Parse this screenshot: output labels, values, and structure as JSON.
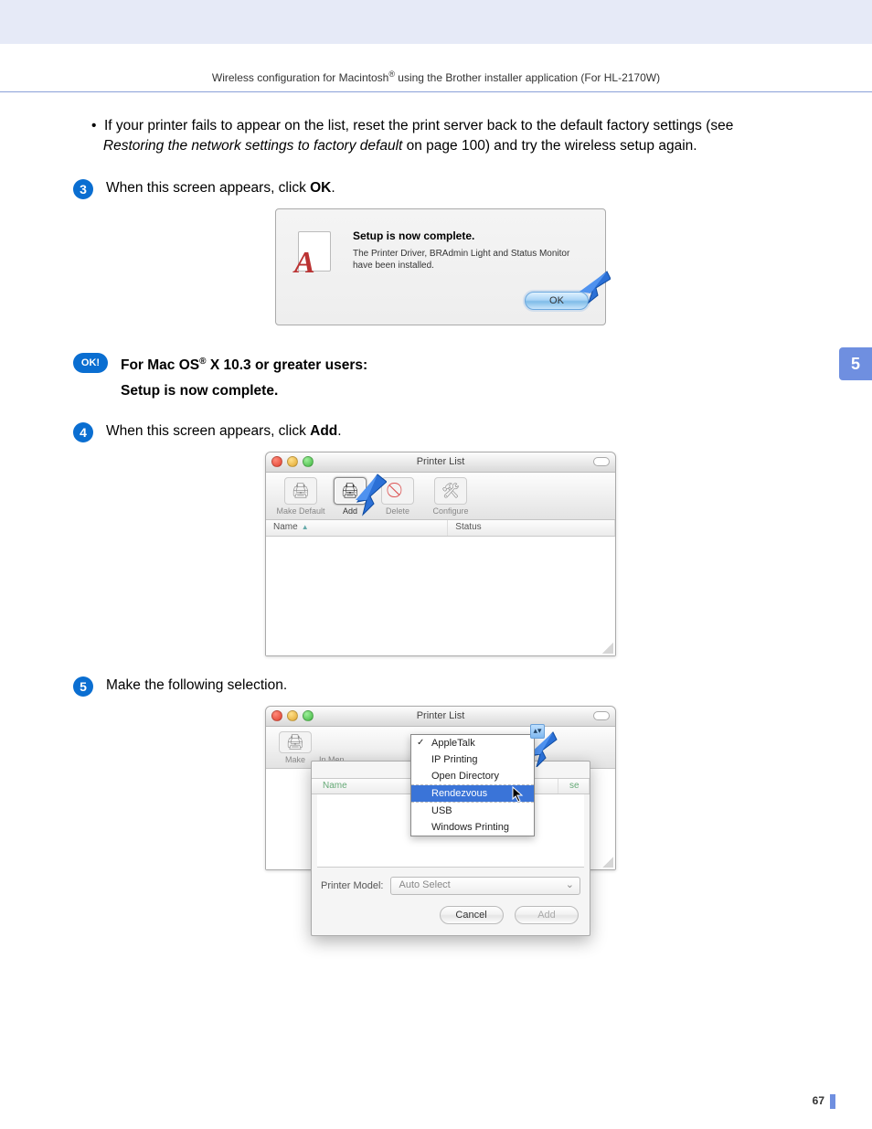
{
  "header": {
    "text_before_reg": "Wireless configuration for Macintosh",
    "text_after_reg": " using the Brother installer application (For HL-2170W)"
  },
  "bullet": {
    "line1": "If your printer fails to appear on the list, reset the print server back to the default factory settings (see ",
    "italic": "Restoring the network settings to factory default",
    "line2": " on page 100) and try the wireless setup again."
  },
  "step3": {
    "num": "3",
    "text_before": "When this screen appears, click ",
    "bold": "OK",
    "after": "."
  },
  "dialog1": {
    "title": "Setup is now complete.",
    "body": "The Printer Driver, BRAdmin Light and Status Monitor have been installed.",
    "ok": "OK"
  },
  "ok_block": {
    "pill": "OK!",
    "line1_before": "For Mac OS",
    "line1_after": " X 10.3 or greater users:",
    "line2": "Setup is now complete."
  },
  "step4": {
    "num": "4",
    "text_before": "When this screen appears, click ",
    "bold": "Add",
    "after": "."
  },
  "printer_list": {
    "title": "Printer List",
    "buttons": {
      "make_default": "Make Default",
      "add": "Add",
      "delete": "Delete",
      "configure": "Configure"
    },
    "columns": {
      "name": "Name",
      "status": "Status"
    }
  },
  "step5": {
    "num": "5",
    "text": "Make the following selection."
  },
  "sheet": {
    "dropdown": {
      "appletalk": "AppleTalk",
      "ip": "IP Printing",
      "opendir": "Open Directory",
      "rendezvous": "Rendezvous",
      "usb": "USB",
      "windows": "Windows Printing"
    },
    "col_name": "Name",
    "col_right_suffix": "se",
    "model_label": "Printer Model:",
    "model_value": "Auto Select",
    "cancel": "Cancel",
    "add": "Add",
    "behind_labels": {
      "make": "Make",
      "in_menu": "In Men"
    }
  },
  "side_tab": "5",
  "page_number": "67"
}
